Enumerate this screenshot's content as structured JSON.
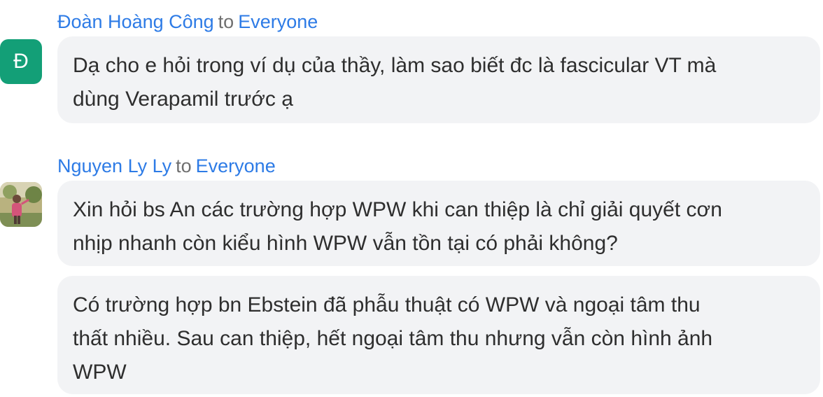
{
  "messages": [
    {
      "sender": "Đoàn Hoàng Công",
      "to_word": "to",
      "recipient": "Everyone",
      "avatar": {
        "type": "letter",
        "letter": "Đ",
        "color": "#139f77"
      },
      "bubbles": [
        {
          "lines": [
            "Dạ cho e hỏi trong ví dụ của thầy, làm sao biết đc là fascicular VT mà",
            "dùng Verapamil trước ạ"
          ]
        }
      ]
    },
    {
      "sender": "Nguyen Ly Ly",
      "to_word": "to",
      "recipient": "Everyone",
      "avatar": {
        "type": "photo",
        "icon": "user-photo"
      },
      "bubbles": [
        {
          "lines": [
            "Xin hỏi bs An các trường hợp WPW khi can thiệp là chỉ giải quyết cơn",
            "nhịp nhanh còn kiểu hình WPW vẫn tồn tại có phải không?"
          ]
        },
        {
          "lines": [
            "Có trường hợp bn Ebstein đã phẫu thuật có WPW và ngoại tâm thu",
            "thất nhiều. Sau can thiệp, hết ngoại tâm thu nhưng vẫn còn hình ảnh",
            "WPW"
          ]
        }
      ]
    }
  ],
  "colors": {
    "name": "#2d7be6",
    "to_word": "#6f6f6f",
    "bubble_bg": "#f2f3f5",
    "text": "#2e2e2e"
  }
}
